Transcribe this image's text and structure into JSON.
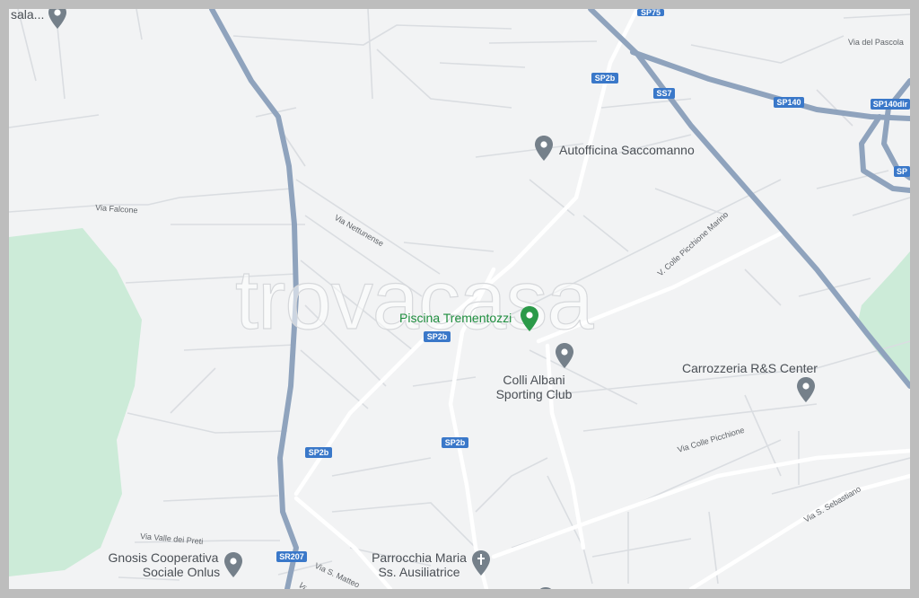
{
  "watermark": "trovacasa",
  "colors": {
    "background": "#f2f3f4",
    "park": "#ccebd8",
    "highway": "#8fa3bd",
    "road": "#ffffff",
    "minor_road": "#d9dce0",
    "poi_gray": "#75808a",
    "poi_green": "#2b9a49",
    "shield": "#3a78c9"
  },
  "pois": [
    {
      "id": "autofficina",
      "name": "Autofficina Saccomanno",
      "icon": "map-pin-icon"
    },
    {
      "id": "piscina",
      "name": "Piscina Trementozzi",
      "icon": "map-pin-green-icon"
    },
    {
      "id": "colli",
      "name": "Colli Albani Sporting Club",
      "lines": [
        "Colli Albani",
        "Sporting Club"
      ],
      "icon": "map-pin-icon"
    },
    {
      "id": "carrozzeria",
      "name": "Carrozzeria R&S Center",
      "icon": "map-pin-icon"
    },
    {
      "id": "gnosis",
      "name": "Gnosis Cooperativa Sociale Onlus",
      "lines": [
        "Gnosis Cooperativa",
        "Sociale Onlus"
      ],
      "icon": "map-pin-icon"
    },
    {
      "id": "parrocchia",
      "name": "Parrocchia Maria Ss. Ausiliatrice",
      "lines": [
        "Parrocchia Maria",
        "Ss. Ausiliatrice"
      ],
      "icon": "church-pin-icon"
    },
    {
      "id": "sala",
      "name": "sala...",
      "icon": "map-pin-icon"
    }
  ],
  "road_labels": {
    "via_pascolare": "Via del Pascola",
    "via_falcone": "Via Falcone",
    "via_nettunense": "Via Nettunense",
    "colle_picchione_marino": "V. Colle Picchione Marino",
    "colle_picchione": "Via Colle Picchione",
    "via_sebastiano": "Via S. Sebastiano",
    "valle_preti": "Via Valle dei Preti",
    "via_matteo": "Via S. Matteo",
    "vi": "Vi"
  },
  "shields": {
    "sp75": "SP75",
    "sp2b": "SP2b",
    "ss7": "SS7",
    "sp140": "SP140",
    "sp140dir": "SP140dir",
    "sp": "SP",
    "sr207": "SR207"
  }
}
